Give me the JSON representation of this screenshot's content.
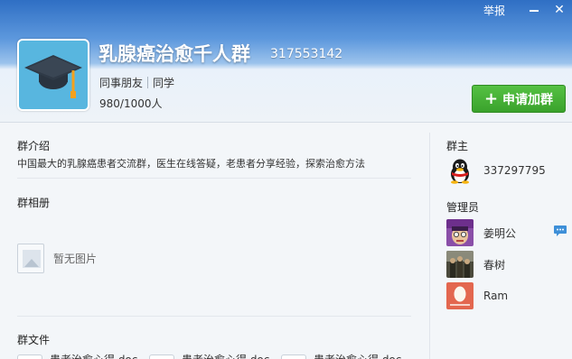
{
  "topbar": {
    "report_label": "举报"
  },
  "group": {
    "name": "乳腺癌治愈千人群",
    "id": "317553142",
    "tags": [
      "同事朋友",
      "同学"
    ],
    "member_count": "980/1000人",
    "avatar_icon": "graduation-cap-icon"
  },
  "actions": {
    "apply_label": "申请加群"
  },
  "intro": {
    "title": "群介绍",
    "text": "中国最大的乳腺癌患者交流群，医生在线答疑，老患者分享经验，探索治愈方法"
  },
  "album": {
    "title": "群相册",
    "empty_text": "暂无图片"
  },
  "files": {
    "title": "群文件",
    "items": [
      {
        "name": "患者治愈心得.doc"
      },
      {
        "name": "患者治愈心得.doc"
      },
      {
        "name": "患者治愈心得.doc"
      }
    ]
  },
  "owner": {
    "title": "群主",
    "id": "337297795"
  },
  "admins": {
    "title": "管理员",
    "list": [
      {
        "name": "姜明公"
      },
      {
        "name": "春树"
      },
      {
        "name": "Ram"
      }
    ]
  },
  "colors": {
    "accent_green": "#3aa22c",
    "header_blue": "#2f6fc4",
    "avatar_bg": "#58b6df"
  }
}
